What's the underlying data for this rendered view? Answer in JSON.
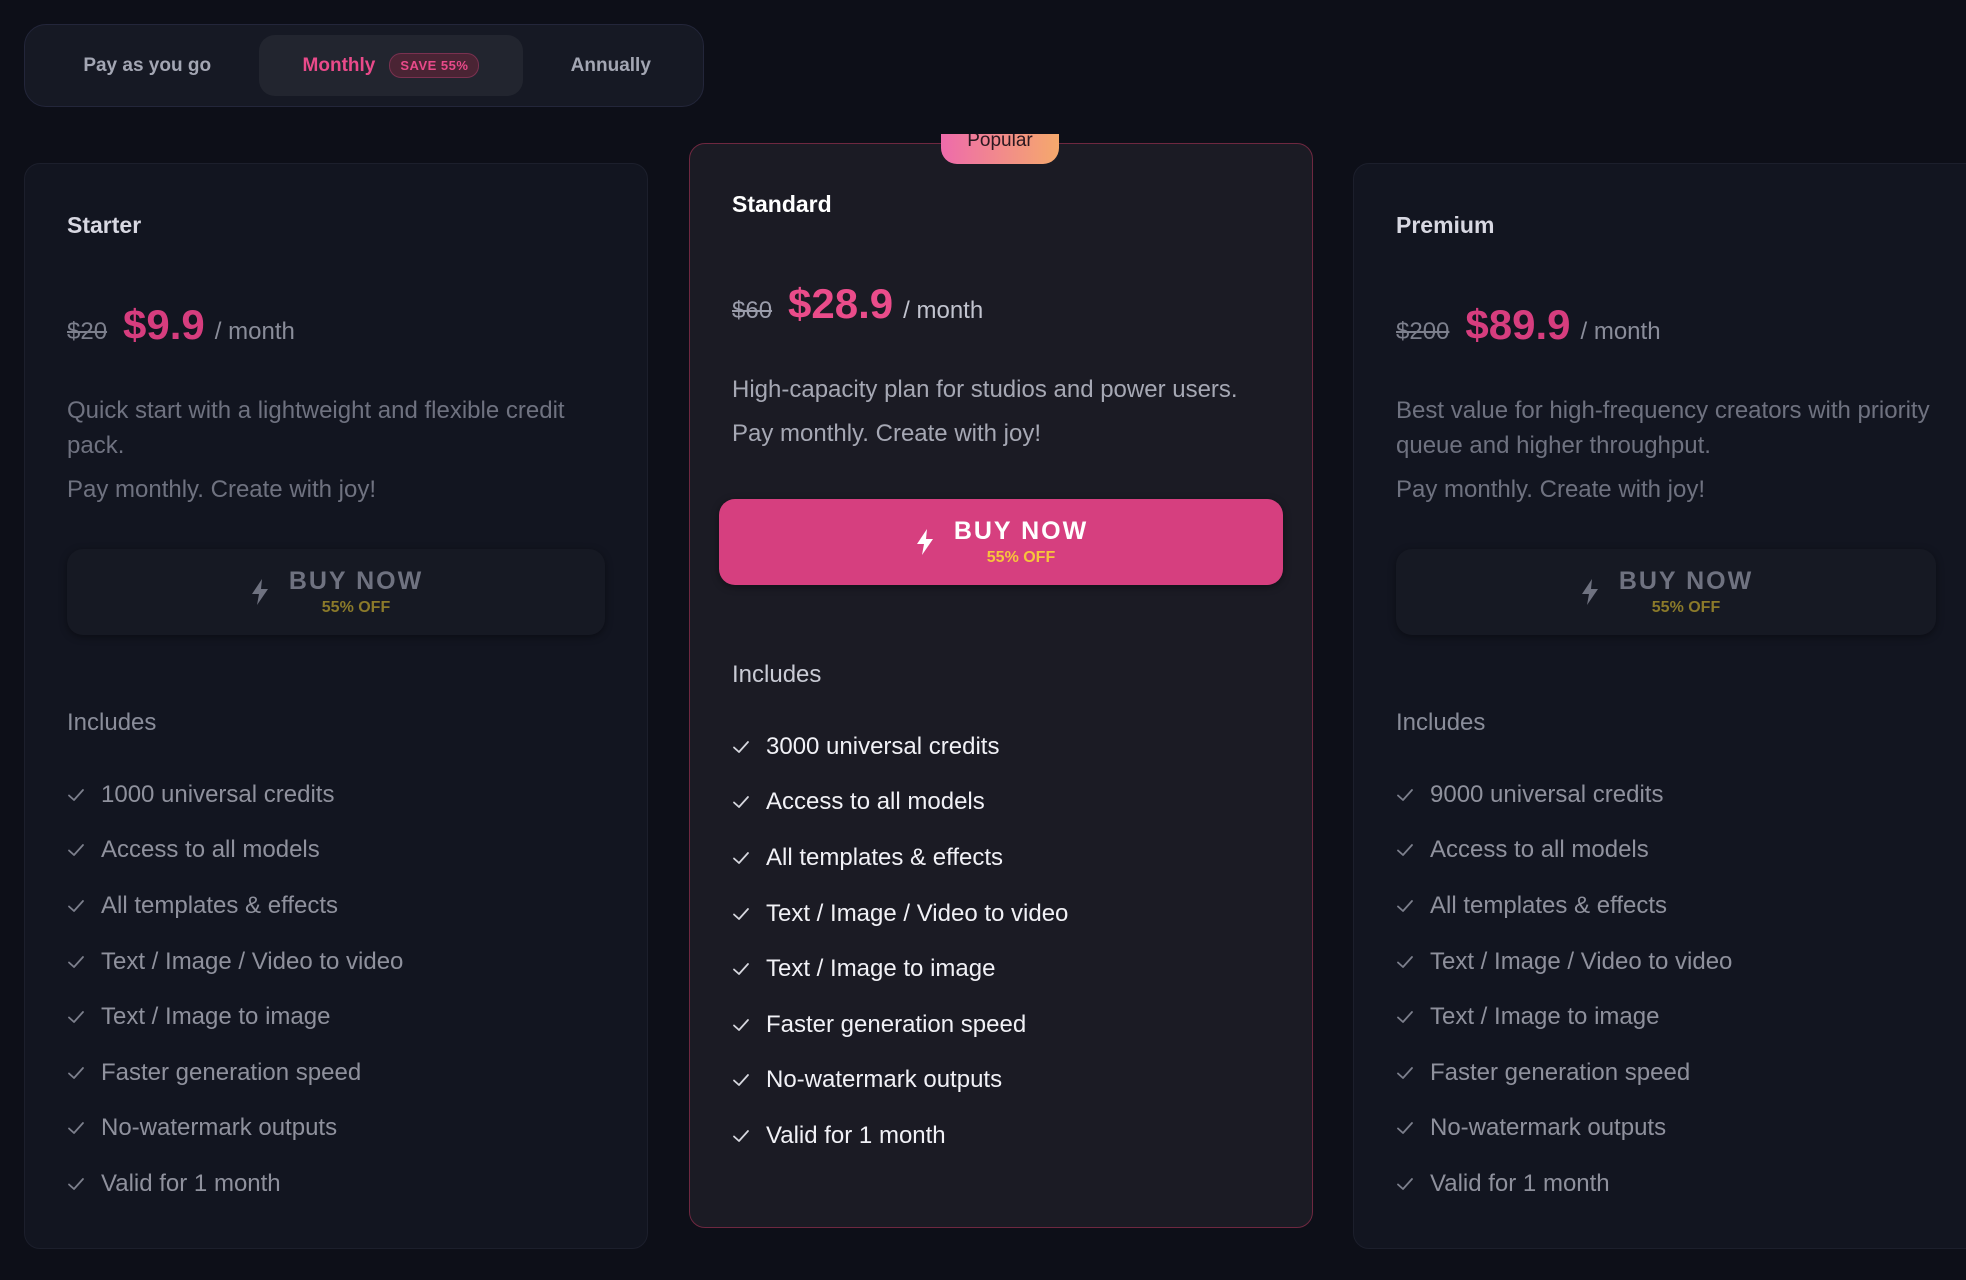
{
  "billing": {
    "options": [
      "Pay as you go",
      "Monthly",
      "Annually"
    ],
    "selected": "Monthly",
    "save_badge": "SAVE 55%"
  },
  "plans": [
    {
      "name": "Starter",
      "old_price": "$20",
      "price": "$9.9",
      "period": "/ month",
      "description": "Quick start with a lightweight and flexible credit pack.",
      "tagline": "Pay monthly. Create with joy!",
      "button_label": "BUY NOW",
      "button_sub": "55% OFF",
      "includes_title": "Includes",
      "features": [
        "1000 universal credits",
        "Access to all models",
        "All templates & effects",
        "Text / Image / Video to video",
        "Text / Image to image",
        "Faster generation speed",
        "No-watermark outputs",
        "Valid for 1 month"
      ]
    },
    {
      "name": "Standard",
      "badge": "Popular",
      "old_price": "$60",
      "price": "$28.9",
      "period": "/ month",
      "description": "High-capacity plan for studios and power users.",
      "tagline": "Pay monthly. Create with joy!",
      "button_label": "BUY NOW",
      "button_sub": "55% OFF",
      "includes_title": "Includes",
      "features": [
        "3000 universal credits",
        "Access to all models",
        "All templates & effects",
        "Text / Image / Video to video",
        "Text / Image to image",
        "Faster generation speed",
        "No-watermark outputs",
        "Valid for 1 month"
      ]
    },
    {
      "name": "Premium",
      "old_price": "$200",
      "price": "$89.9",
      "period": "/ month",
      "description": "Best value for high-frequency creators with priority queue and higher throughput.",
      "tagline": "Pay monthly. Create with joy!",
      "button_label": "BUY NOW",
      "button_sub": "55% OFF",
      "includes_title": "Includes",
      "features": [
        "9000 universal credits",
        "Access to all models",
        "All templates & effects",
        "Text / Image / Video to video",
        "Text / Image to image",
        "Faster generation speed",
        "No-watermark outputs",
        "Valid for 1 month"
      ]
    }
  ],
  "colors": {
    "background": "#0d0f18",
    "accent": "#d63f7f",
    "highlight": "#f7c43c"
  },
  "icons": {
    "buy": "bolt-icon",
    "feature": "check-icon"
  }
}
